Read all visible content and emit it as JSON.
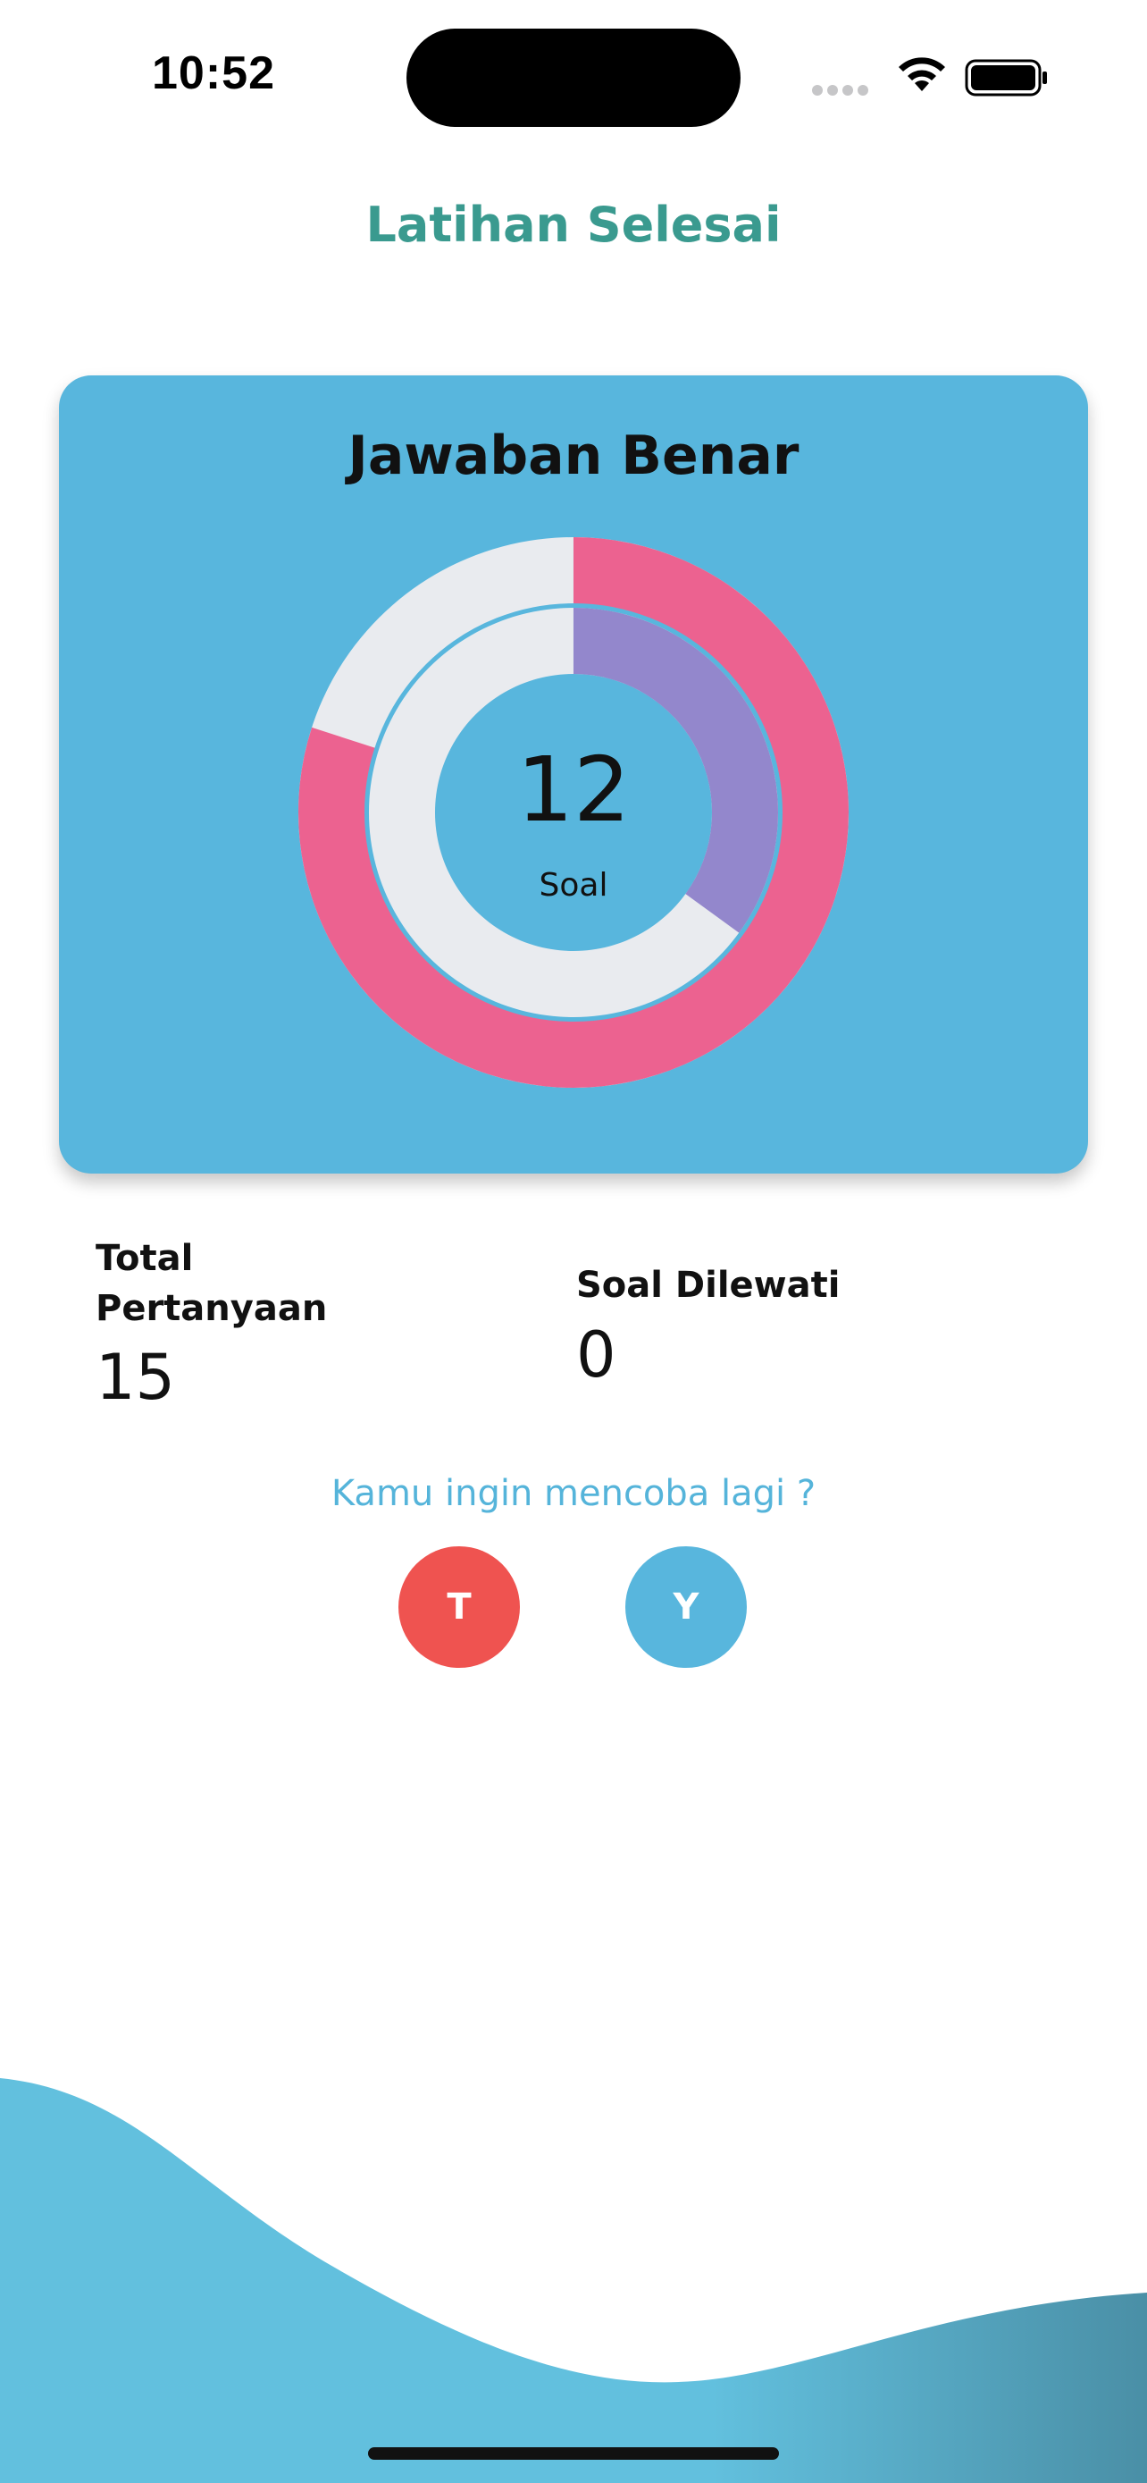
{
  "status_bar": {
    "time": "10:52"
  },
  "header": {
    "title": "Latihan Selesai"
  },
  "card": {
    "title": "Jawaban Benar",
    "center_value": "12",
    "center_label": "Soal"
  },
  "stats": {
    "total_label": "Total Pertanyaan",
    "total_value": "15",
    "skipped_label": "Soal Dilewati",
    "skipped_value": "0"
  },
  "retry": {
    "question": "Kamu ingin mencoba lagi ?",
    "no_label": "T",
    "yes_label": "Y"
  },
  "chart_data": {
    "type": "donut",
    "series": [
      {
        "value": 12,
        "max": 15
      },
      {
        "value": 0.35,
        "max": 1
      }
    ]
  },
  "colors": {
    "accent": "#58b6dd",
    "title": "#3a9a8f",
    "outer_ring": "#ec6290",
    "inner_ring": "#9387cc",
    "track": "#e9ebef",
    "no_button": "#ef5350"
  }
}
